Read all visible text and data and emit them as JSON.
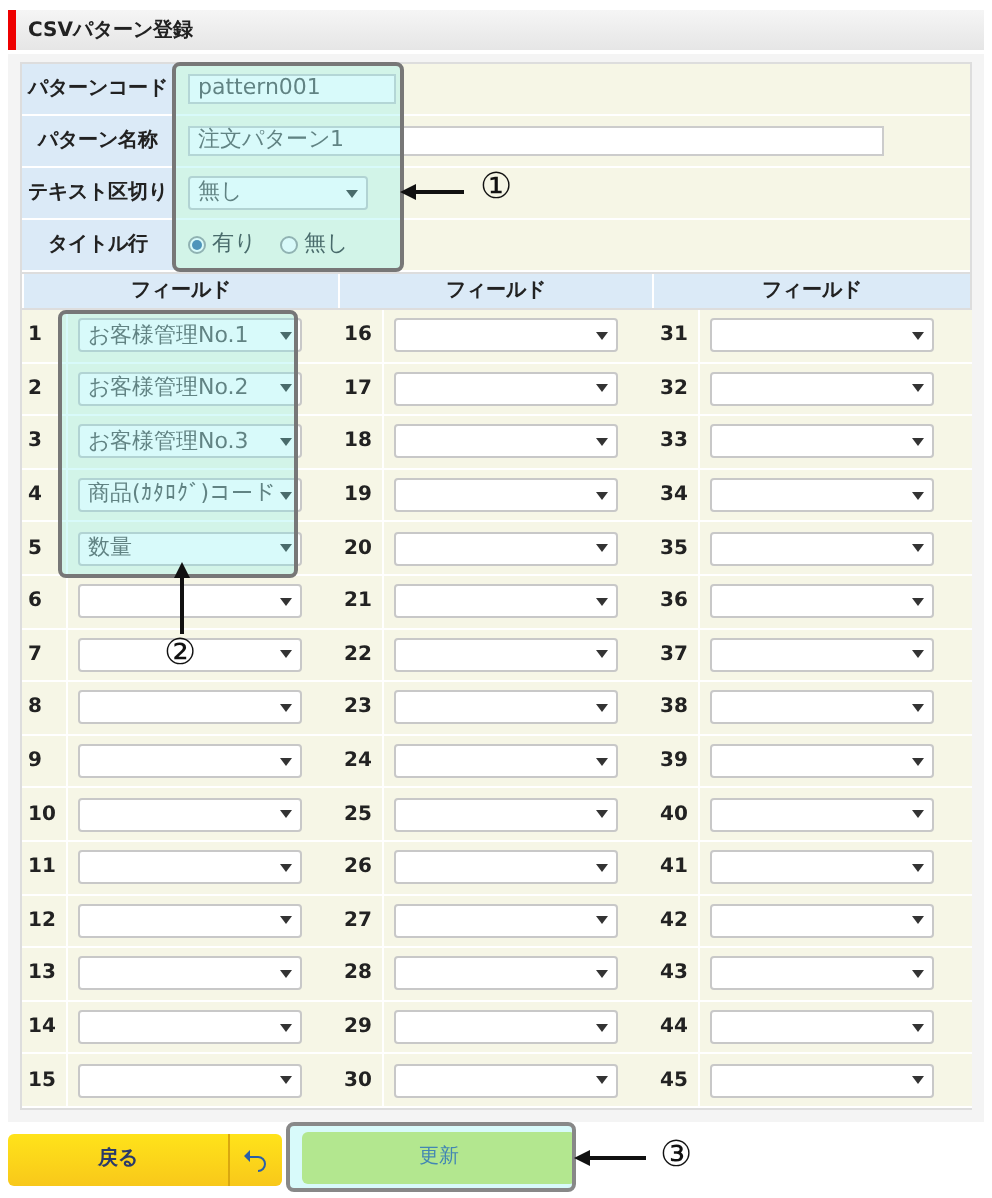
{
  "page_title": "CSVパターン登録",
  "form": [
    {
      "kind": "text",
      "label": "パターンコード",
      "value": "pattern001"
    },
    {
      "kind": "wide_text",
      "label": "パターン名称",
      "value": "注文パターン1"
    },
    {
      "kind": "select",
      "label": "テキスト区切り",
      "value": "無し"
    },
    {
      "kind": "radio",
      "label": "タイトル行",
      "options": [
        {
          "label": "有り",
          "selected": true
        },
        {
          "label": "無し",
          "selected": false
        }
      ]
    }
  ],
  "fields": {
    "columns": [
      "フィールド",
      "フィールド",
      "フィールド"
    ],
    "rows": [
      {
        "number": "1",
        "value": "お客様管理No.1"
      },
      {
        "number": "2",
        "value": "お客様管理No.2"
      },
      {
        "number": "3",
        "value": "お客様管理No.3"
      },
      {
        "number": "4",
        "value": "商品(ｶﾀﾛｸﾞ)コード"
      },
      {
        "number": "5",
        "value": "数量"
      },
      {
        "number": "6"
      },
      {
        "number": "7"
      },
      {
        "number": "8"
      },
      {
        "number": "9"
      },
      {
        "number": "10"
      },
      {
        "number": "11"
      },
      {
        "number": "12"
      },
      {
        "number": "13"
      },
      {
        "number": "14"
      },
      {
        "number": "15"
      },
      {
        "number": "16"
      },
      {
        "number": "17"
      },
      {
        "number": "18"
      },
      {
        "number": "19"
      },
      {
        "number": "20"
      },
      {
        "number": "21"
      },
      {
        "number": "22"
      },
      {
        "number": "23"
      },
      {
        "number": "24"
      },
      {
        "number": "25"
      },
      {
        "number": "26"
      },
      {
        "number": "27"
      },
      {
        "number": "28"
      },
      {
        "number": "29"
      },
      {
        "number": "30"
      },
      {
        "number": "31"
      },
      {
        "number": "32"
      },
      {
        "number": "33"
      },
      {
        "number": "34"
      },
      {
        "number": "35"
      },
      {
        "number": "36"
      },
      {
        "number": "37"
      },
      {
        "number": "38"
      },
      {
        "number": "39"
      },
      {
        "number": "40"
      },
      {
        "number": "41"
      },
      {
        "number": "42"
      },
      {
        "number": "43"
      },
      {
        "number": "44"
      },
      {
        "number": "45"
      }
    ]
  },
  "buttons": [
    {
      "kind": "back",
      "label": "戻る"
    },
    {
      "kind": "primary",
      "label": "更新"
    }
  ],
  "callouts": [
    "①",
    "②",
    "③"
  ]
}
